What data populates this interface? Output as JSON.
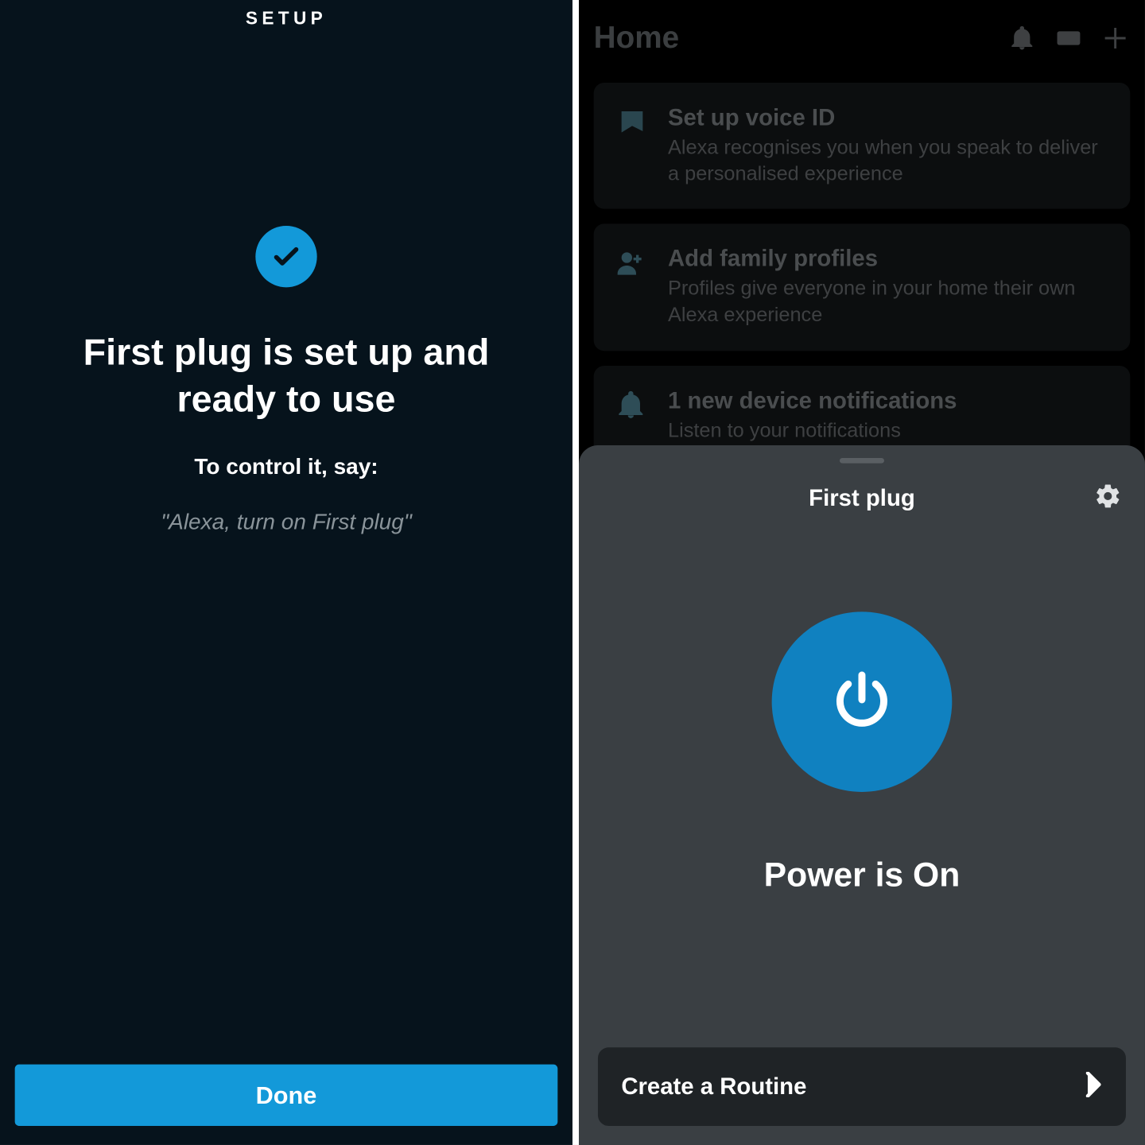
{
  "colors": {
    "accent": "#1399d9",
    "sheet_bg": "#3a3f43",
    "dark_bg": "#06131c"
  },
  "left": {
    "header": "SETUP",
    "title": "First plug is set up and ready to use",
    "subtitle": "To control it, say:",
    "hint": "\"Alexa, turn on First plug\"",
    "done": "Done"
  },
  "right": {
    "home_title": "Home",
    "cards": [
      {
        "icon": "voice-id-icon",
        "title": "Set up voice ID",
        "sub": "Alexa recognises you when you speak to deliver a personalised experience"
      },
      {
        "icon": "family-icon",
        "title": "Add family profiles",
        "sub": "Profiles give everyone in your home their own Alexa experience"
      },
      {
        "icon": "bell-icon",
        "title": "1 new device notifications",
        "sub": "Listen to your notifications"
      }
    ],
    "sheet": {
      "title": "First plug",
      "status": "Power is On",
      "routine": "Create a Routine"
    }
  }
}
